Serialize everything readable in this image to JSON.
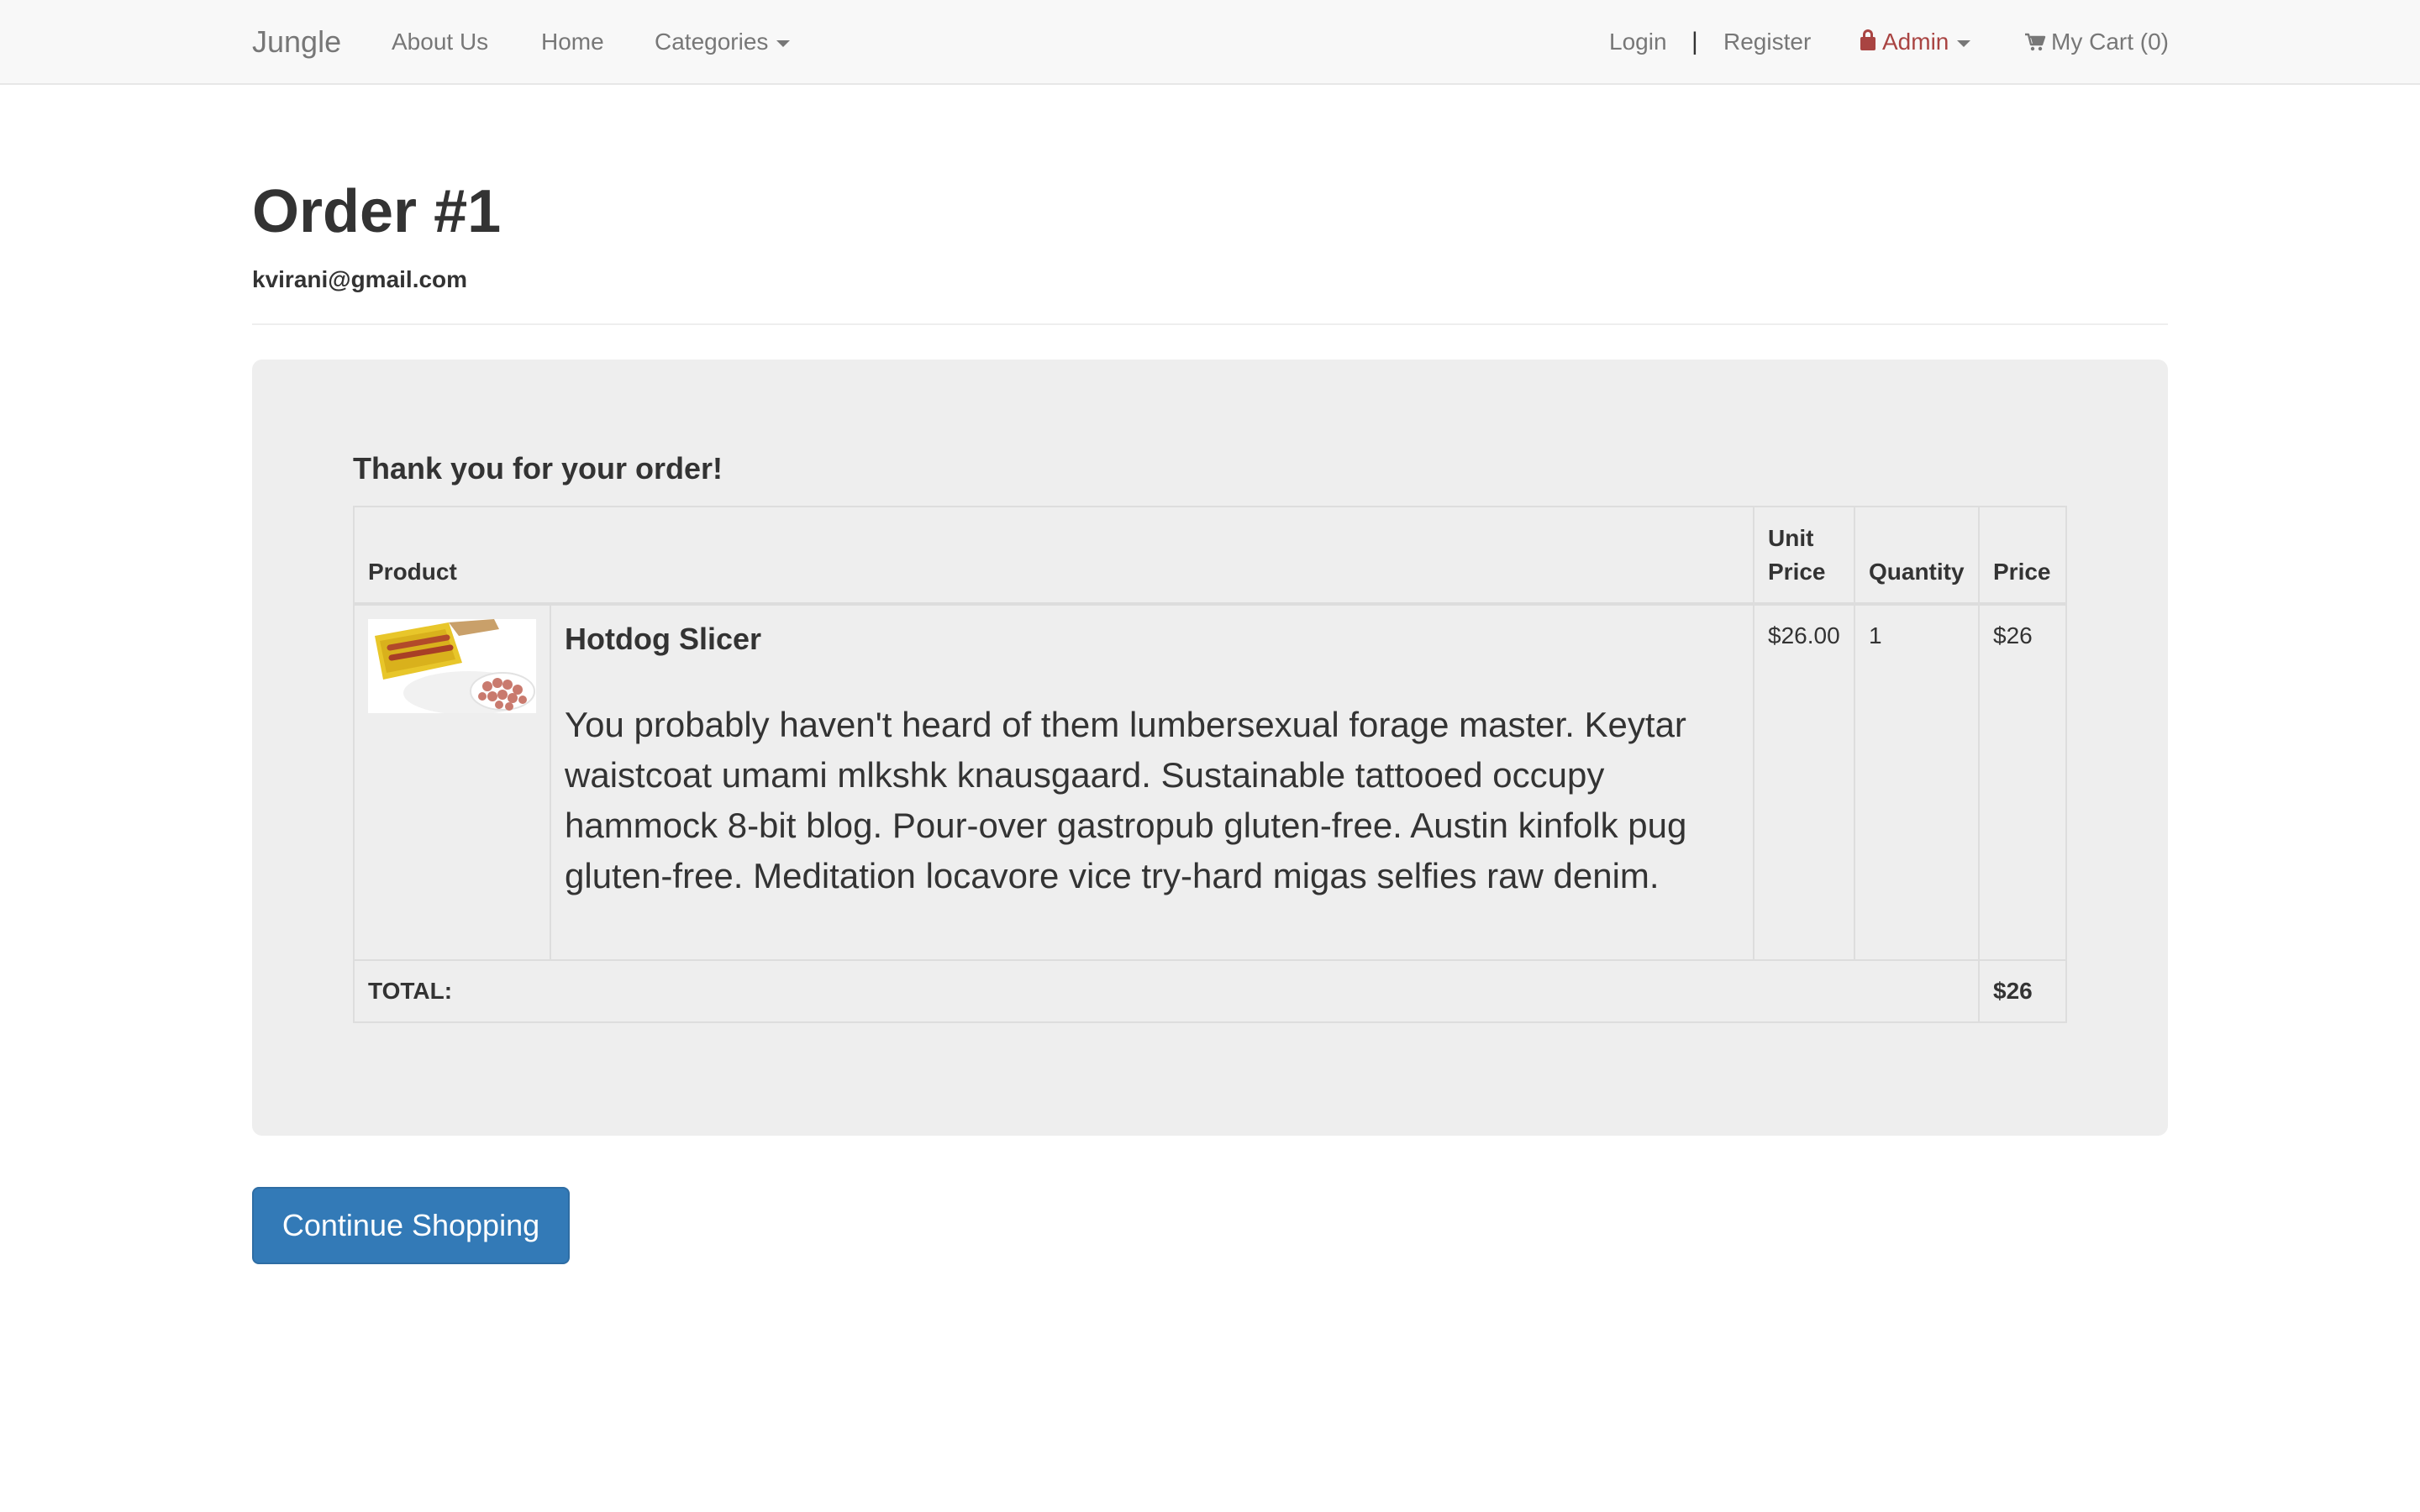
{
  "navbar": {
    "brand": "Jungle",
    "links": {
      "about": "About Us",
      "home": "Home",
      "categories": "Categories",
      "login": "Login",
      "separator": "|",
      "register": "Register",
      "admin": "Admin",
      "cart": "My Cart (0)"
    },
    "colors": {
      "background": "#f8f8f8",
      "link": "#777777",
      "admin": "#a94442"
    }
  },
  "header": {
    "title": "Order #1",
    "email": "kvirani@gmail.com"
  },
  "order": {
    "thanks": "Thank you for your order!",
    "columns": {
      "product": "Product",
      "unit_price": "Unit Price",
      "quantity": "Quantity",
      "price": "Price"
    },
    "items": [
      {
        "name": "Hotdog Slicer",
        "description": "You probably haven't heard of them lumbersexual forage master. Keytar waistcoat umami mlkshk knausgaard. Sustainable tattooed occupy hammock 8-bit blog. Pour-over gastropub gluten-free. Austin kinfolk pug gluten-free. Meditation locavore vice try-hard migas selfies raw denim.",
        "unit_price": "$26.00",
        "quantity": "1",
        "price": "$26"
      }
    ],
    "total_label": "TOTAL:",
    "total_value": "$26"
  },
  "actions": {
    "continue_label": "Continue Shopping",
    "button_color": "#337ab7"
  },
  "icons": {
    "lock": "lock-icon",
    "cart": "shopping-cart-icon",
    "caret": "caret-down-icon"
  }
}
